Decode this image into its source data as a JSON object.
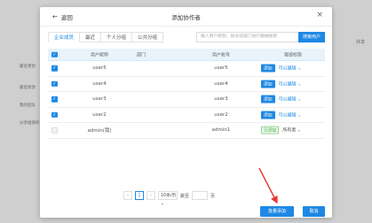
{
  "background": {
    "side_items": [
      "最近更新",
      "最近修改",
      "我的团队",
      "分享给我的"
    ],
    "right_text": "共享"
  },
  "modal": {
    "back_label": "返回",
    "title": "添加协作者",
    "close_icon": "close-icon"
  },
  "tabs": [
    "企业成员",
    "最近",
    "个人分组",
    "公共分组"
  ],
  "search": {
    "placeholder": "输入用户昵称、账号或部门进行模糊搜索",
    "button": "搜索用户"
  },
  "table": {
    "headers": [
      "用户昵称",
      "部门",
      "用户账号",
      "赛缦权限"
    ],
    "rows": [
      {
        "name": "user5",
        "dept": "",
        "account": "user5",
        "action": "添加",
        "mode": "可以编辑"
      },
      {
        "name": "user4",
        "dept": "",
        "account": "user4",
        "action": "添加",
        "mode": "可以编辑"
      },
      {
        "name": "user3",
        "dept": "",
        "account": "user3",
        "action": "添加",
        "mode": "可以编辑"
      },
      {
        "name": "user2",
        "dept": "",
        "account": "user2",
        "action": "添加",
        "mode": "可以编辑"
      },
      {
        "name": "admin(我)",
        "dept": "",
        "account": "admin1",
        "action": "已添加",
        "mode": "所有者"
      }
    ]
  },
  "pagination": {
    "prev": "‹",
    "current": "1",
    "next": "›",
    "page_size": "10条/页",
    "goto_label": "跳至",
    "page_suffix": "页"
  },
  "footer": {
    "batch_add": "批量添加",
    "cancel": "取消"
  },
  "colors": {
    "accent": "#1e88e5",
    "annotation": "#e53935"
  }
}
